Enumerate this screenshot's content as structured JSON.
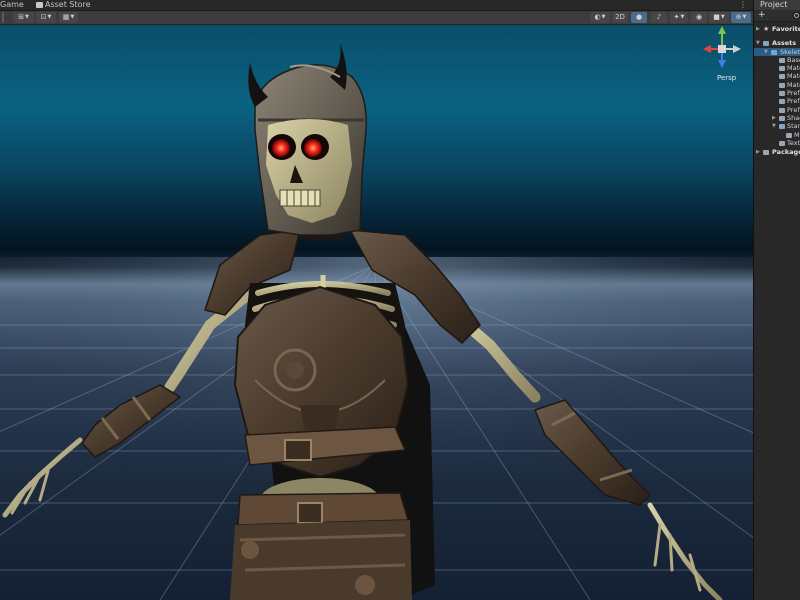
{
  "tabs": {
    "game": "Game",
    "asset_store": "Asset Store"
  },
  "toolbar": {
    "mode_2d": "2D",
    "persp_label": "Persp"
  },
  "project": {
    "title": "Project",
    "add_label": "+",
    "favorites": "Favorites",
    "assets": "Assets",
    "skeleton_folder": "Skeleto",
    "children": [
      "Base",
      "Mate",
      "Mate",
      "Mate",
      "Prefa",
      "Prefa",
      "Prefa",
      "Shad",
      "Stan",
      "M",
      "Text"
    ],
    "packages": "Packages"
  },
  "colors": {
    "selection": "#2c5d87",
    "gizmo_y": "#7ec34c",
    "gizmo_x": "#e2453c",
    "gizmo_z": "#3f7fde",
    "eye_glow": "#ff2a1a"
  },
  "icons": [
    "game-icon",
    "asset-store-bag-icon",
    "panel-menu-icon",
    "transform-tools-icon",
    "grid-snap-icon",
    "draw-mode-icon",
    "lighting-icon",
    "audio-icon",
    "effects-icon",
    "visibility-icon",
    "camera-icon",
    "gizmos-icon",
    "search-icon",
    "star-icon",
    "folder-icon"
  ]
}
